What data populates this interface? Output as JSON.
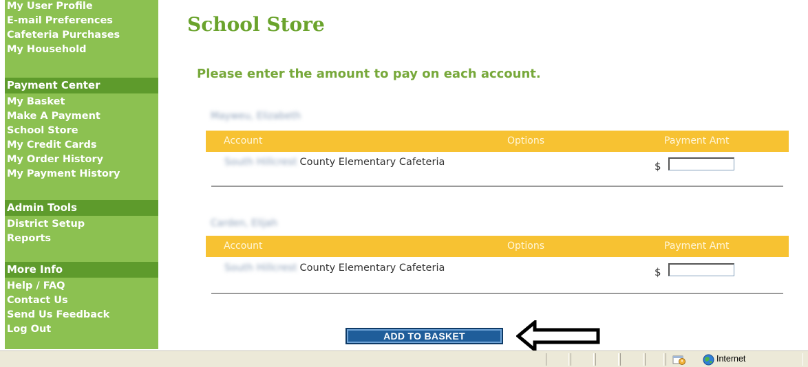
{
  "sidebar": {
    "account_links": [
      "My User Profile",
      "E-mail Preferences",
      "Cafeteria Purchases",
      "My Household"
    ],
    "payment_center": {
      "header": "Payment Center",
      "links": [
        "My Basket",
        "Make A Payment",
        "School Store",
        "My Credit Cards",
        "My Order History",
        "My Payment History"
      ]
    },
    "admin_tools": {
      "header": "Admin Tools",
      "links": [
        "District Setup",
        "Reports"
      ]
    },
    "more_info": {
      "header": "More Info",
      "links": [
        "Help / FAQ",
        "Contact Us",
        "Send Us Feedback",
        "Log Out"
      ]
    }
  },
  "main": {
    "title": "School Store",
    "instructions": "Please enter the amount to pay on each account.",
    "columns": [
      "Account",
      "Options",
      "Payment Amt"
    ],
    "students": [
      {
        "name": "Mayweu, Elizabeth",
        "account_prefix": "South Hillcrest",
        "account": "County Elementary Cafeteria",
        "currency": "$",
        "payment_amt": ""
      },
      {
        "name": "Carden, Elijah",
        "account_prefix": "South Hillcrest",
        "account": "County Elementary Cafeteria",
        "currency": "$",
        "payment_amt": ""
      }
    ],
    "add_button": "ADD TO BASKET"
  },
  "statusbar": {
    "zone": "Internet"
  },
  "colors": {
    "sidebar_bg": "#8cc151",
    "section_header_bg": "#5e9b2c",
    "title": "#6aa32c",
    "table_header_bg": "#f7c232",
    "button_bg": "#1f5d9a"
  }
}
